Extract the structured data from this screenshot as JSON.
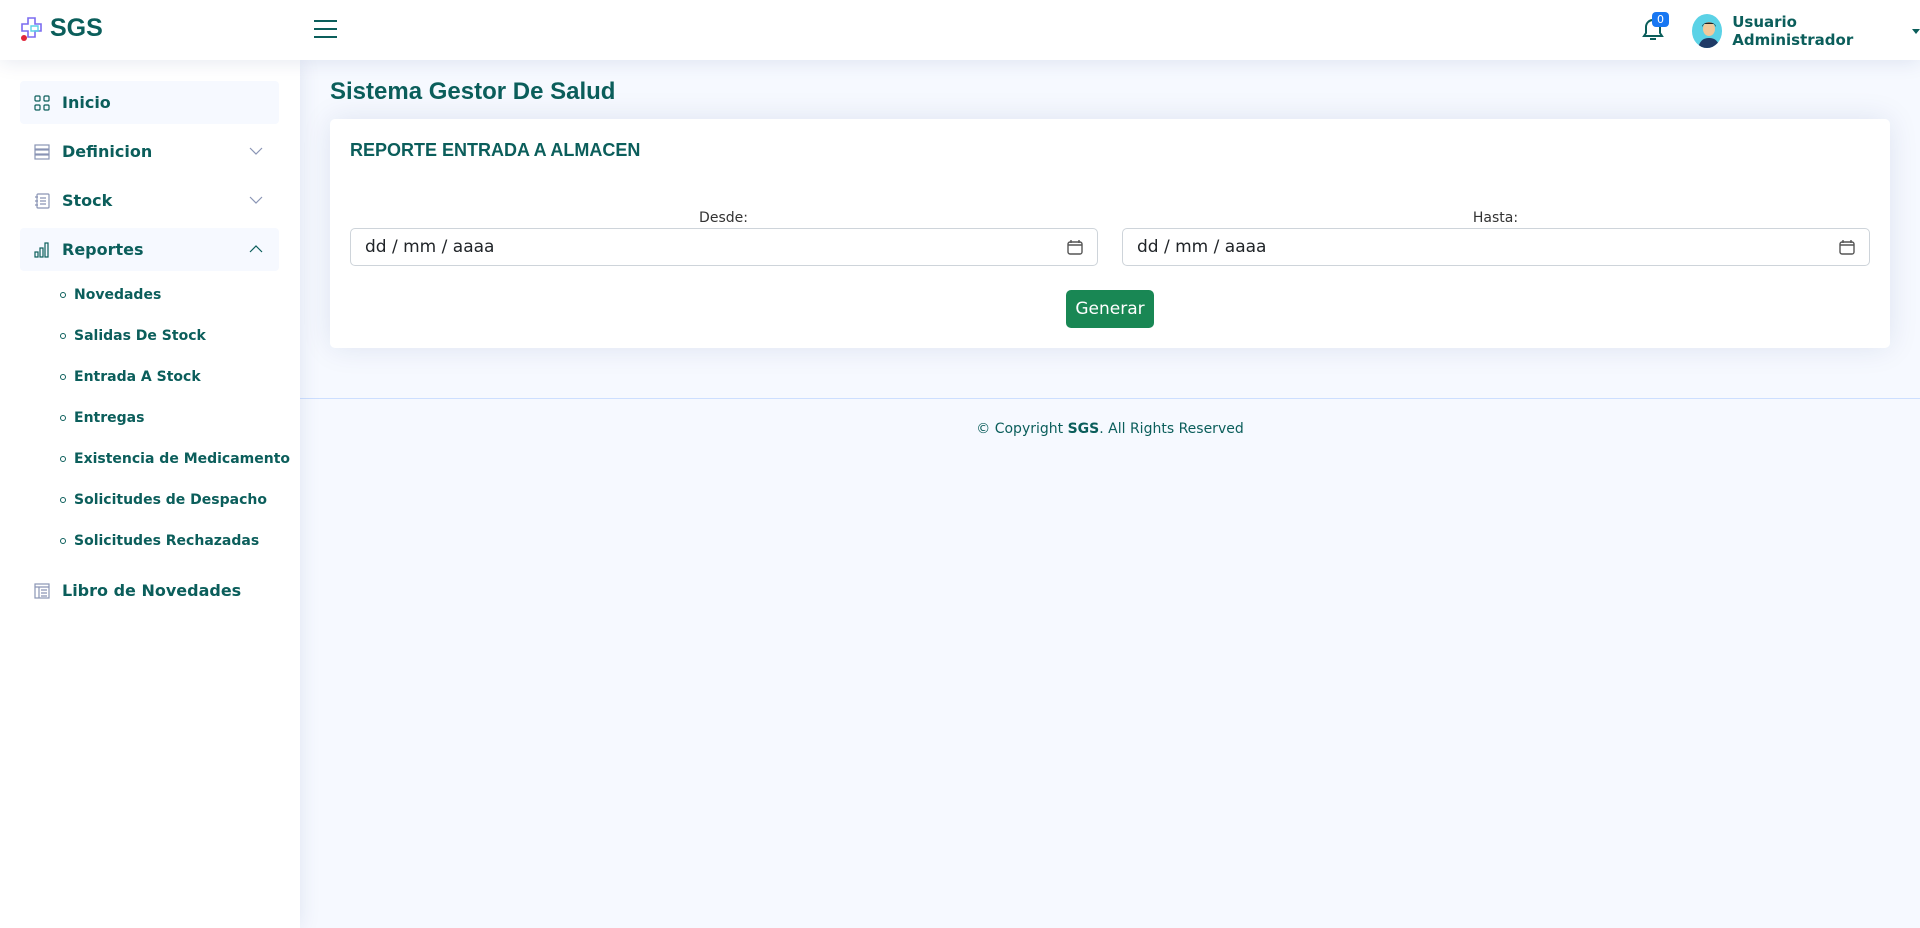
{
  "header": {
    "logo_text": "SGS",
    "notification_count": "0",
    "user_name": "Usuario Administrador"
  },
  "sidebar": {
    "items": [
      {
        "label": "Inicio",
        "icon": "grid-icon"
      },
      {
        "label": "Definicion",
        "icon": "list-icon"
      },
      {
        "label": "Stock",
        "icon": "journal-icon"
      },
      {
        "label": "Reportes",
        "icon": "bar-chart-icon"
      }
    ],
    "subitems": [
      "Novedades",
      "Salidas De Stock",
      "Entrada A Stock",
      "Entregas",
      "Existencia de Medicamento",
      "Solicitudes de Despacho",
      "Solicitudes Rechazadas"
    ],
    "libro": "Libro de Novedades"
  },
  "main": {
    "page_title": "Sistema Gestor De Salud",
    "card_title": "REPORTE ENTRADA A ALMACEN",
    "desde_label": "Desde:",
    "hasta_label": "Hasta:",
    "desde_placeholder": "dd / mm / aaaa",
    "hasta_placeholder": "dd / mm / aaaa",
    "generate_label": "Generar"
  },
  "footer": {
    "prefix": "© Copyright ",
    "brand": "SGS",
    "suffix": ". All Rights Reserved"
  },
  "colors": {
    "primary_text": "#0b5e5b",
    "button": "#198754",
    "badge": "#1877f2"
  }
}
